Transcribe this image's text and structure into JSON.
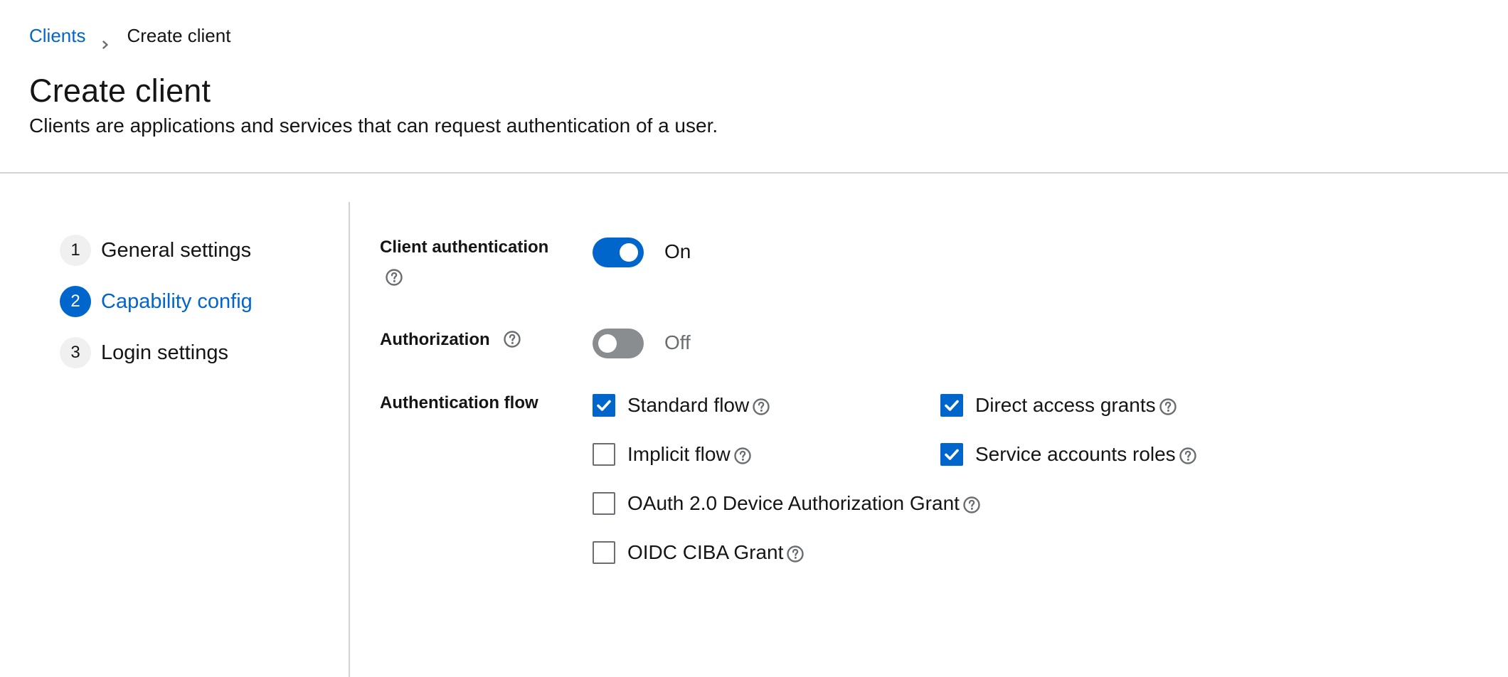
{
  "breadcrumb": {
    "parent": "Clients",
    "current": "Create client"
  },
  "header": {
    "title": "Create client",
    "description": "Clients are applications and services that can request authentication of a user."
  },
  "wizard": {
    "steps": [
      {
        "number": "1",
        "label": "General settings",
        "state": "completed"
      },
      {
        "number": "2",
        "label": "Capability config",
        "state": "current"
      },
      {
        "number": "3",
        "label": "Login settings",
        "state": "upcoming"
      }
    ]
  },
  "form": {
    "client_authentication": {
      "label": "Client authentication",
      "enabled": true,
      "state_label": "On"
    },
    "authorization": {
      "label": "Authorization",
      "enabled": false,
      "state_label": "Off"
    },
    "authentication_flow": {
      "label": "Authentication flow",
      "options": [
        {
          "label": "Standard flow",
          "checked": true
        },
        {
          "label": "Direct access grants",
          "checked": true
        },
        {
          "label": "Implicit flow",
          "checked": false
        },
        {
          "label": "Service accounts roles",
          "checked": true
        },
        {
          "label": "OAuth 2.0 Device Authorization Grant",
          "checked": false
        },
        {
          "label": "OIDC CIBA Grant",
          "checked": false
        }
      ]
    }
  },
  "icons": {
    "help": "question-circle-icon",
    "checkmark": "check-icon",
    "breadcrumb_separator": "chevron-right-icon"
  },
  "colors": {
    "accent": "#0066cc",
    "switch_off": "#8a8d90",
    "divider": "#d2d2d2",
    "text": "#151515",
    "muted": "#6a6e73"
  }
}
